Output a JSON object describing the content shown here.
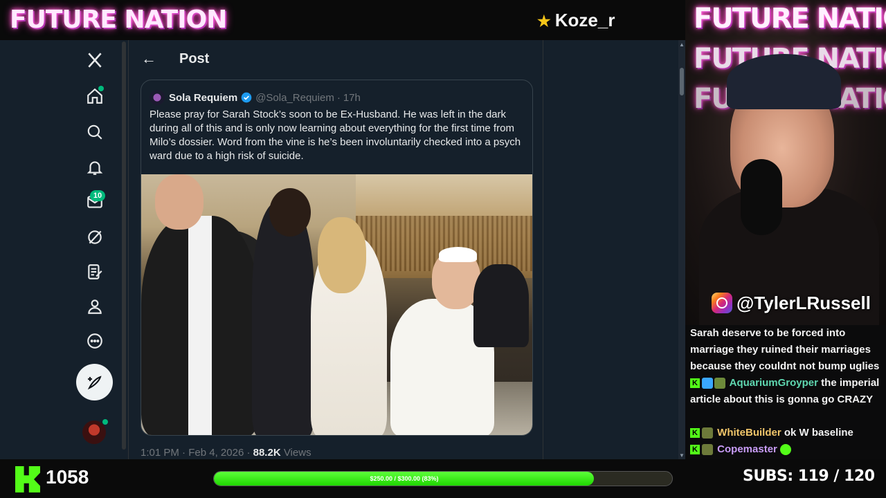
{
  "overlay": {
    "brand": "FUTURE NATION",
    "streamer_name": "Koze_r",
    "cam_brand": "FUTURE NATION",
    "instagram_handle": "@TylerLRussell",
    "followers": "1058",
    "goal_text": "$250.00 / $300.00 (83%)",
    "goal_progress": 0.83,
    "subs_label": "SUBS:",
    "subs_value": "119 / 120",
    "accent_color": "#53fc18"
  },
  "sidebar": {
    "items": [
      {
        "icon": "x-logo-icon"
      },
      {
        "icon": "home-icon"
      },
      {
        "icon": "search-icon"
      },
      {
        "icon": "notifications-icon"
      },
      {
        "icon": "messages-icon",
        "badge": "10"
      },
      {
        "icon": "grok-icon"
      },
      {
        "icon": "lists-icon"
      },
      {
        "icon": "profile-icon"
      },
      {
        "icon": "more-icon"
      }
    ],
    "compose_icon": "compose-icon"
  },
  "header": {
    "title": "Post"
  },
  "quote": {
    "name": "Sola Requiem",
    "handle": "@Sola_Requiem",
    "dot": "·",
    "time": "17h",
    "text": "Please pray for Sarah Stock’s soon to be Ex-Husband. He was left in the dark during all of this and is only now learning about everything for the first time from Milo’s dossier. Word from the vine is he’s been involuntarily checked into a psych ward due to a high risk of suicide."
  },
  "meta": {
    "time": "1:01 PM",
    "dot1": "·",
    "date": "Feb 4, 2026",
    "dot2": "·",
    "views_count": "88.2K",
    "views_label": "Views"
  },
  "chat": [
    {
      "user": "",
      "text": "Sarah deserve to be forced into marriage they ruined their marriages because they couldnt not bump uglies",
      "color": ""
    },
    {
      "user": "AquariumGroyper",
      "text": "the imperial article about this is gonna go CRAZY",
      "color": "#5fd7b0"
    },
    {
      "user": "WhiteBuilder",
      "text": "ok W baseline",
      "color": "#f0c56a"
    },
    {
      "user": "Copemaster",
      "text": "",
      "color": "#c89cf7"
    }
  ]
}
